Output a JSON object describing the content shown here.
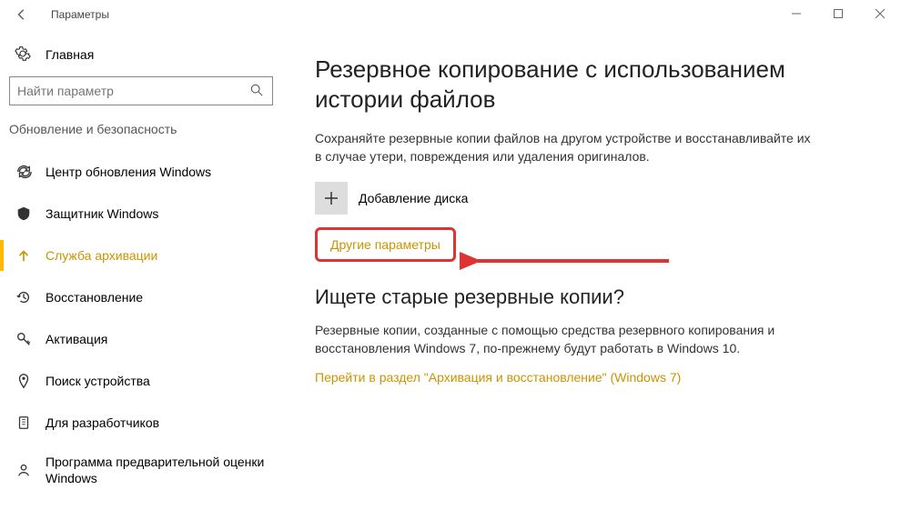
{
  "window": {
    "title": "Параметры"
  },
  "sidebar": {
    "home": "Главная",
    "search_placeholder": "Найти параметр",
    "section": "Обновление и безопасность",
    "items": [
      {
        "label": "Центр обновления Windows"
      },
      {
        "label": "Защитник Windows"
      },
      {
        "label": "Служба архивации"
      },
      {
        "label": "Восстановление"
      },
      {
        "label": "Активация"
      },
      {
        "label": "Поиск устройства"
      },
      {
        "label": "Для разработчиков"
      },
      {
        "label": "Программа предварительной оценки Windows"
      }
    ]
  },
  "main": {
    "h1": "Резервное копирование с использованием истории файлов",
    "desc1": "Сохраняйте резервные копии файлов на другом устройстве и восстанавливайте их в случае утери, повреждения или удаления оригиналов.",
    "add_drive": "Добавление диска",
    "more_options": "Другие параметры",
    "h2": "Ищете старые резервные копии?",
    "desc2": "Резервные копии, созданные с помощью средства резервного копирования и восстановления Windows 7, по-прежнему будут работать в Windows 10.",
    "link": "Перейти в раздел \"Архивация и восстановление\" (Windows 7)"
  }
}
